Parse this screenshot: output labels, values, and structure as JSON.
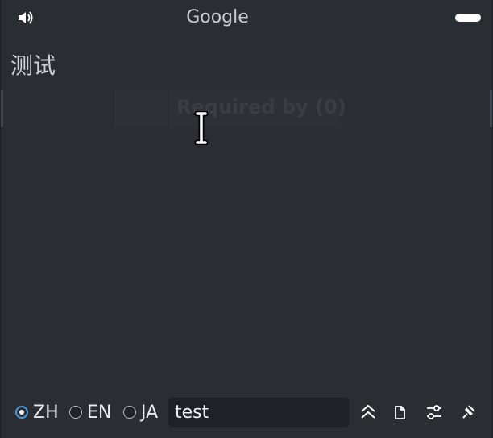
{
  "header": {
    "title": "Google",
    "speaker_icon": "speaker-icon",
    "menu_icon": "pill-menu-icon"
  },
  "content": {
    "word": "测试",
    "faint_text": "Required by (0)"
  },
  "footer": {
    "languages": [
      {
        "label": "ZH",
        "selected": true
      },
      {
        "label": "EN",
        "selected": false
      },
      {
        "label": "JA",
        "selected": false
      }
    ],
    "input_value": "test",
    "toolbar_icons": [
      "collapse-up-icon",
      "copy-icon",
      "settings-sliders-icon",
      "pin-icon"
    ]
  },
  "colors": {
    "background": "#2a2e33",
    "input_background": "#1e2125",
    "radio_accent": "#4b9ad8",
    "text": "#e7eaee"
  }
}
